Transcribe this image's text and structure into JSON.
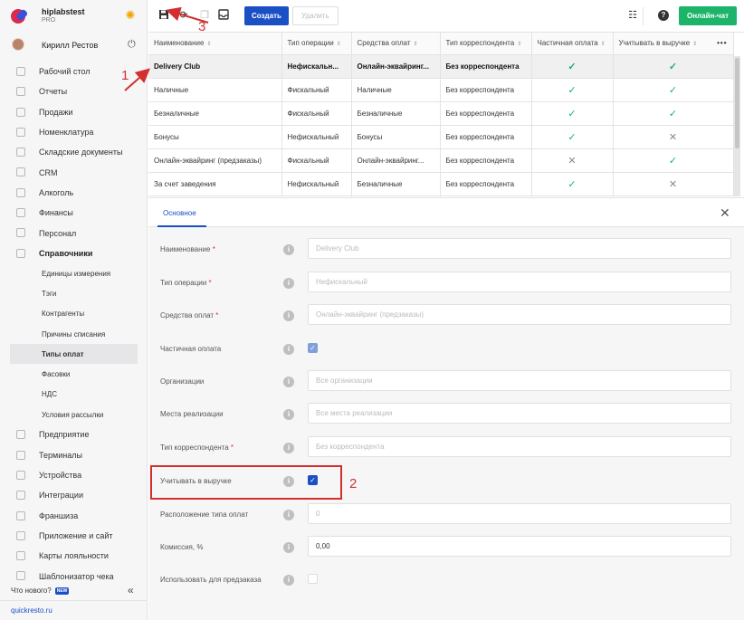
{
  "brand": {
    "name": "hiplabstest",
    "tier": "PRO"
  },
  "user": {
    "name": "Кирилл Рестов"
  },
  "nav": [
    {
      "label": "Рабочий стол",
      "icon": "dashboard-icon"
    },
    {
      "label": "Отчеты",
      "icon": "chart-icon"
    },
    {
      "label": "Продажи",
      "icon": "basket-icon"
    },
    {
      "label": "Номенклатура",
      "icon": "tag-icon"
    },
    {
      "label": "Складские документы",
      "icon": "box-icon"
    },
    {
      "label": "CRM",
      "icon": "users-icon"
    },
    {
      "label": "Алкоголь",
      "icon": "glass-icon"
    },
    {
      "label": "Финансы",
      "icon": "wallet-icon"
    },
    {
      "label": "Персонал",
      "icon": "person-icon"
    },
    {
      "label": "Справочники",
      "icon": "book-icon"
    }
  ],
  "subnav": [
    "Единицы измерения",
    "Тэги",
    "Контрагенты",
    "Причины списания",
    "Типы оплат",
    "Фасовки",
    "НДС",
    "Условия рассылки"
  ],
  "nav2": [
    {
      "label": "Предприятие",
      "icon": "building-icon"
    },
    {
      "label": "Терминалы",
      "icon": "terminal-icon"
    },
    {
      "label": "Устройства",
      "icon": "printer-icon"
    },
    {
      "label": "Интеграции",
      "icon": "link-icon"
    },
    {
      "label": "Франшиза",
      "icon": "network-icon"
    },
    {
      "label": "Приложение и сайт",
      "icon": "app-icon"
    },
    {
      "label": "Карты лояльности",
      "icon": "card-icon"
    },
    {
      "label": "Шаблонизатор чека",
      "icon": "receipt-icon"
    }
  ],
  "footer": {
    "whatsnew": "Что нового?",
    "badge": "NEW",
    "link": "quickresto.ru"
  },
  "toolbar": {
    "create": "Создать",
    "delete": "Удалить",
    "chat": "Онлайн-чат"
  },
  "table": {
    "headers": [
      "Наименование",
      "Тип операции",
      "Средства оплат",
      "Тип корреспондента",
      "Частичная оплата",
      "Учитывать в выручке"
    ],
    "rows": [
      [
        "Delivery Club",
        "Нефискальн...",
        "Онлайн-эквайринг...",
        "Без корреспондента",
        true,
        true
      ],
      [
        "Наличные",
        "Фискальный",
        "Наличные",
        "Без корреспондента",
        true,
        true
      ],
      [
        "Безналичные",
        "Фискальный",
        "Безналичные",
        "Без корреспондента",
        true,
        true
      ],
      [
        "Бонусы",
        "Нефискальный",
        "Бонусы",
        "Без корреспондента",
        true,
        false
      ],
      [
        "Онлайн-эквайринг (предзаказы)",
        "Фискальный",
        "Онлайн-эквайринг...",
        "Без корреспондента",
        false,
        true
      ],
      [
        "За счет заведения",
        "Нефискальный",
        "Безналичные",
        "Без корреспондента",
        true,
        false
      ]
    ]
  },
  "detail": {
    "tab": "Основное",
    "fields": [
      {
        "label": "Наименование",
        "req": true,
        "type": "input",
        "value": "Delivery Club",
        "filled": false
      },
      {
        "label": "Тип операции",
        "req": true,
        "type": "input",
        "value": "Нефискальный",
        "filled": false
      },
      {
        "label": "Средства оплат",
        "req": true,
        "type": "input",
        "value": "Онлайн-эквайринг (предзаказы)",
        "filled": false
      },
      {
        "label": "Частичная оплата",
        "req": false,
        "type": "check",
        "state": "dim"
      },
      {
        "label": "Организации",
        "req": false,
        "type": "input",
        "value": "Все организации",
        "filled": false
      },
      {
        "label": "Места реализации",
        "req": false,
        "type": "input",
        "value": "Все места реализации",
        "filled": false
      },
      {
        "label": "Тип корреспондента",
        "req": true,
        "type": "input",
        "value": "Без корреспондента",
        "filled": false
      },
      {
        "label": "Учитывать в выручке",
        "req": false,
        "type": "check",
        "state": "on"
      },
      {
        "label": "Расположение типа оплат",
        "req": false,
        "type": "input",
        "value": "0",
        "filled": false
      },
      {
        "label": "Комиссия, %",
        "req": false,
        "type": "input",
        "value": "0,00",
        "filled": true
      },
      {
        "label": "Использовать для предзаказа",
        "req": false,
        "type": "check",
        "state": "off"
      }
    ]
  },
  "annotations": [
    "1",
    "2",
    "3"
  ]
}
